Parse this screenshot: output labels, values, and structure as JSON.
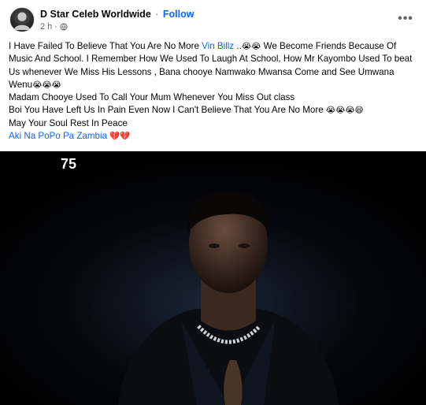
{
  "post": {
    "page_name": "D Star Celeb Worldwide",
    "separator": "·",
    "follow_label": "Follow",
    "time": "2 h",
    "meta_separator": "·",
    "more_label": "•••",
    "lines": {
      "l1_a": "I Have Failed To Believe That You Are No More ",
      "l1_mention": "Vin Billz",
      "l1_b": " ..",
      "l1_emoji": "😭😭",
      "l1_c": " We Become Friends  Because Of Music And School. I Remember How We Used To Laugh At School, How Mr Kayombo Used To beat Us whenever We Miss His Lessons , Bana chooye Namwako Mwansa  Come and See Umwana Wenu",
      "l1_emoji2": "😭😭😭",
      "l2": "Madam Chooye Used To Call Your Mum Whenever You Miss Out class",
      "l3_a": "Boi You Have Left Us In Pain Even Now I Can't Believe That You Are No More ",
      "l3_emoji": "😭😭😭😄",
      "l4": "May Your Soul Rest In Peace",
      "l5_link": "Aki Na PoPo Pa Zambia",
      "l5_hearts": "💔💔"
    },
    "media": {
      "logo_text": "75",
      "description_icon": "person-photo"
    }
  }
}
